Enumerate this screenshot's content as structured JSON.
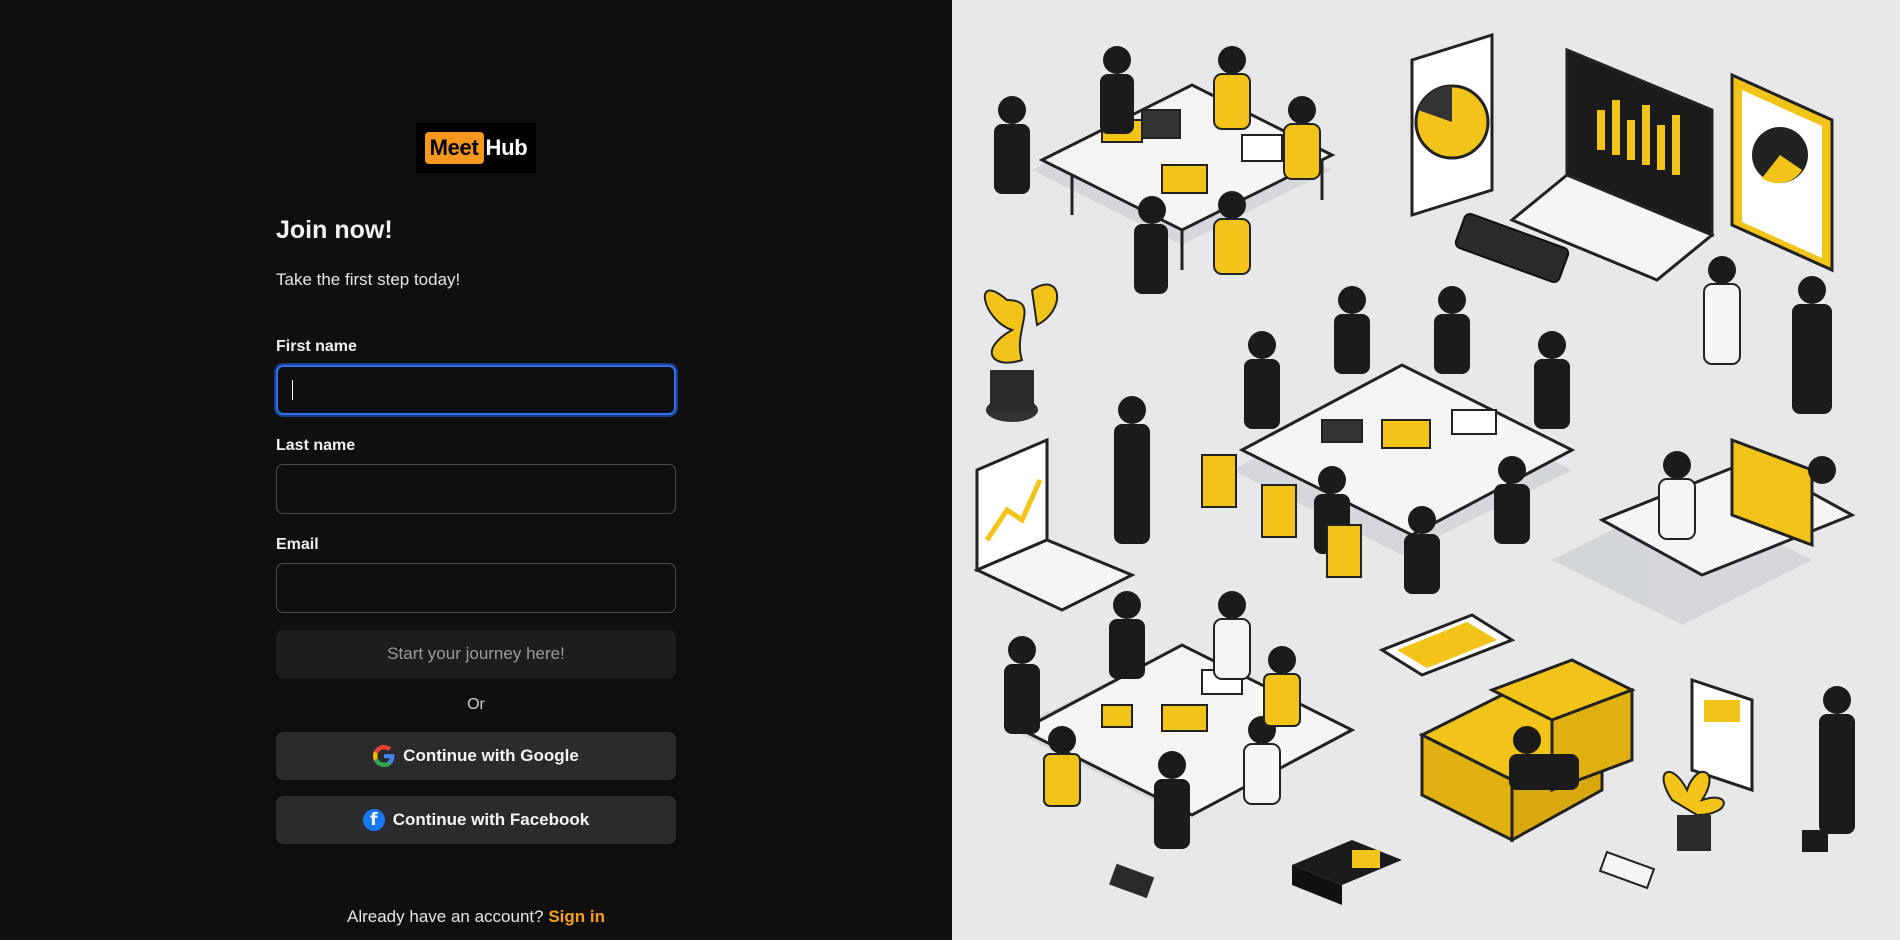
{
  "brand": {
    "part1": "Meet",
    "part2": "Hub",
    "accent": "#f7971d"
  },
  "heading": {
    "title": "Join now!",
    "subtitle": "Take the first step today!"
  },
  "form": {
    "first_name": {
      "label": "First name",
      "value": ""
    },
    "last_name": {
      "label": "Last name",
      "value": ""
    },
    "email": {
      "label": "Email",
      "value": ""
    }
  },
  "actions": {
    "submit_label": "Start your journey here!",
    "or_label": "Or",
    "google_label": "Continue with Google",
    "facebook_label": "Continue with Facebook"
  },
  "footer": {
    "prompt": "Already have an account?",
    "link": "Sign in"
  },
  "colors": {
    "focus": "#2f6fea",
    "link": "#f7a11a",
    "illustration_accent": "#f2c318"
  }
}
